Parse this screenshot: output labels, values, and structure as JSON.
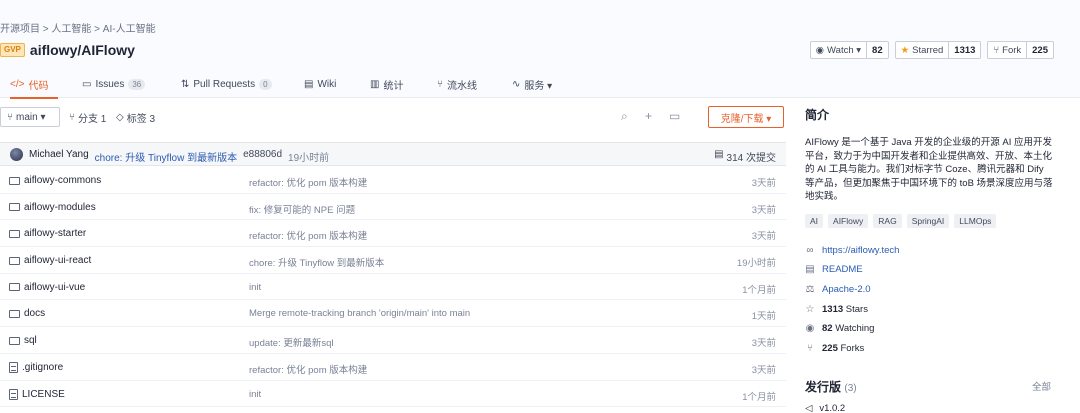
{
  "breadcrumb": "开源项目 > 人工智能 > AI-人工智能",
  "repo": {
    "badge": "GVP",
    "name": "aiflowy/AIFlowy"
  },
  "actions": {
    "watch_label": "Watch ▾",
    "watch_count": "82",
    "star_label": "Starred",
    "star_count": "1313",
    "fork_label": "Fork",
    "fork_count": "225"
  },
  "tabs": [
    {
      "icon": "</>",
      "label": "代码"
    },
    {
      "icon": "▭",
      "label": "Issues",
      "badge": "36"
    },
    {
      "icon": "⇅",
      "label": "Pull Requests",
      "badge": "0"
    },
    {
      "icon": "▤",
      "label": "Wiki"
    },
    {
      "icon": "▥",
      "label": "统计"
    },
    {
      "icon": "⑂",
      "label": "流水线"
    },
    {
      "icon": "∿",
      "label": "服务 ▾"
    }
  ],
  "toolbar": {
    "branch": "main ▾",
    "branches": "分支 1",
    "tags": "标签 3",
    "clone": "克隆/下载 ▾"
  },
  "commit": {
    "author": "Michael Yang",
    "message": "chore: 升级 Tinyflow 到最新版本",
    "hash": "e88806d",
    "time": "19小时前",
    "count": "314 次提交"
  },
  "files": [
    {
      "type": "folder",
      "name": "aiflowy-commons",
      "msg": "refactor: 优化 pom 版本构建",
      "time": "3天前"
    },
    {
      "type": "folder",
      "name": "aiflowy-modules",
      "msg": "fix: 修复可能的 NPE 问题",
      "time": "3天前"
    },
    {
      "type": "folder",
      "name": "aiflowy-starter",
      "msg": "refactor: 优化 pom 版本构建",
      "time": "3天前"
    },
    {
      "type": "folder",
      "name": "aiflowy-ui-react",
      "msg": "chore: 升级 Tinyflow 到最新版本",
      "time": "19小时前"
    },
    {
      "type": "folder",
      "name": "aiflowy-ui-vue",
      "msg": "init",
      "time": "1个月前"
    },
    {
      "type": "folder",
      "name": "docs",
      "msg": "Merge remote-tracking branch 'origin/main' into main",
      "time": "1天前"
    },
    {
      "type": "folder",
      "name": "sql",
      "msg": "update: 更新最新sql",
      "time": "3天前"
    },
    {
      "type": "file",
      "name": ".gitignore",
      "msg": "refactor: 优化 pom 版本构建",
      "time": "3天前"
    },
    {
      "type": "file",
      "name": "LICENSE",
      "msg": "init",
      "time": "1个月前"
    }
  ],
  "sidebar": {
    "heading": "简介",
    "description": "AIFlowy 是一个基于 Java 开发的企业级的开源 AI 应用开发平台，致力于为中国开发者和企业提供高效、开放、本土化的 AI 工具与能力。我们对标字节 Coze、腾讯元器和 Dify 等产品，但更加聚焦于中国环境下的 toB 场景深度应用与落地实践。",
    "tags": [
      "AI",
      "AIFlowy",
      "RAG",
      "SpringAI",
      "LLMOps"
    ],
    "website": "https://aiflowy.tech",
    "readme": "README",
    "license": "Apache-2.0",
    "stars_count": "1313",
    "stars_label": "Stars",
    "watching_count": "82",
    "watching_label": "Watching",
    "forks_count": "225",
    "forks_label": "Forks",
    "releases_label": "发行版",
    "releases_count": "(3)",
    "releases_all": "全部",
    "latest_release": "v1.0.2"
  }
}
